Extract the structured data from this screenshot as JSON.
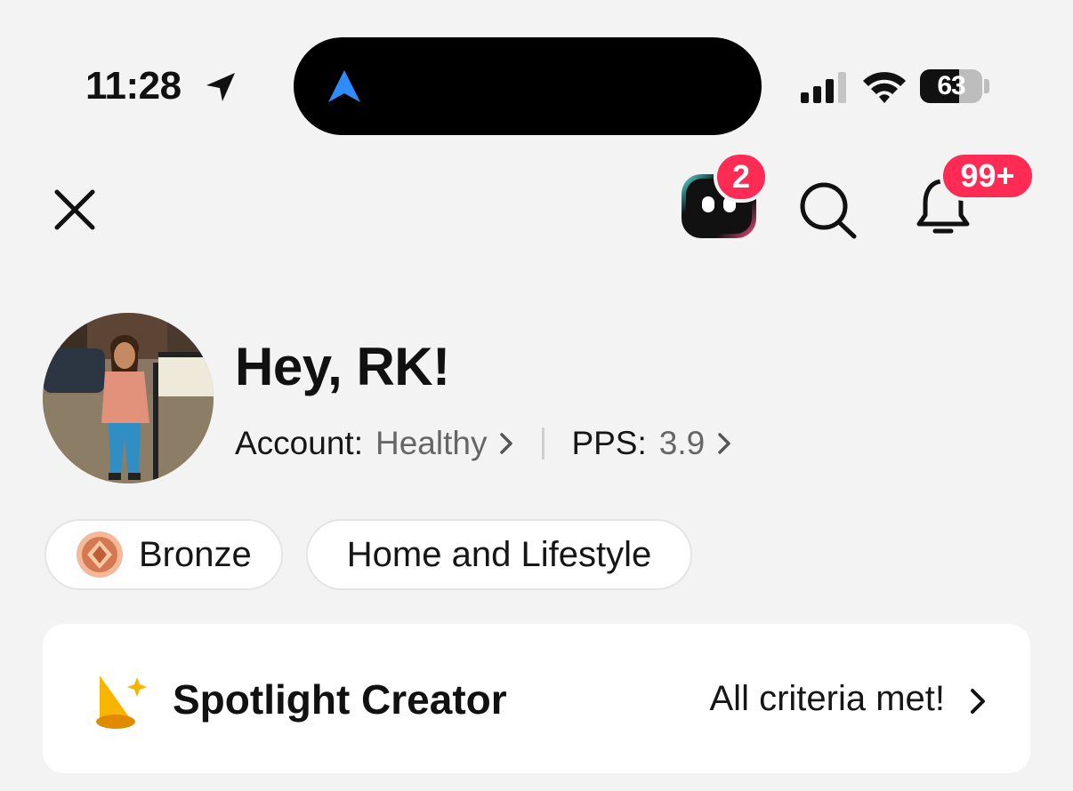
{
  "status_bar": {
    "time": "11:28",
    "battery": "63",
    "battery_level": 0.63,
    "icons": [
      "location-arrow-icon",
      "navigation-arrow-icon",
      "cellular-signal-icon",
      "wifi-icon",
      "battery-icon"
    ]
  },
  "header": {
    "assistant_badge": "2",
    "notifications_badge": "99+",
    "icons": [
      "close-icon",
      "assistant-bot-icon",
      "search-icon",
      "bell-icon"
    ]
  },
  "profile": {
    "greeting": "Hey, RK!",
    "account_label": "Account:",
    "account_value": "Healthy",
    "pps_label": "PPS:",
    "pps_value": "3.9"
  },
  "chips": {
    "tier": "Bronze",
    "niche": "Home and Lifestyle"
  },
  "spotlight": {
    "title": "Spotlight Creator",
    "status": "All criteria met!"
  },
  "colors": {
    "badge_red": "#fe2c55",
    "background": "#f3f3f4",
    "nav_blue": "#2f8cff",
    "spotlight_yellow": "#f7b500"
  }
}
